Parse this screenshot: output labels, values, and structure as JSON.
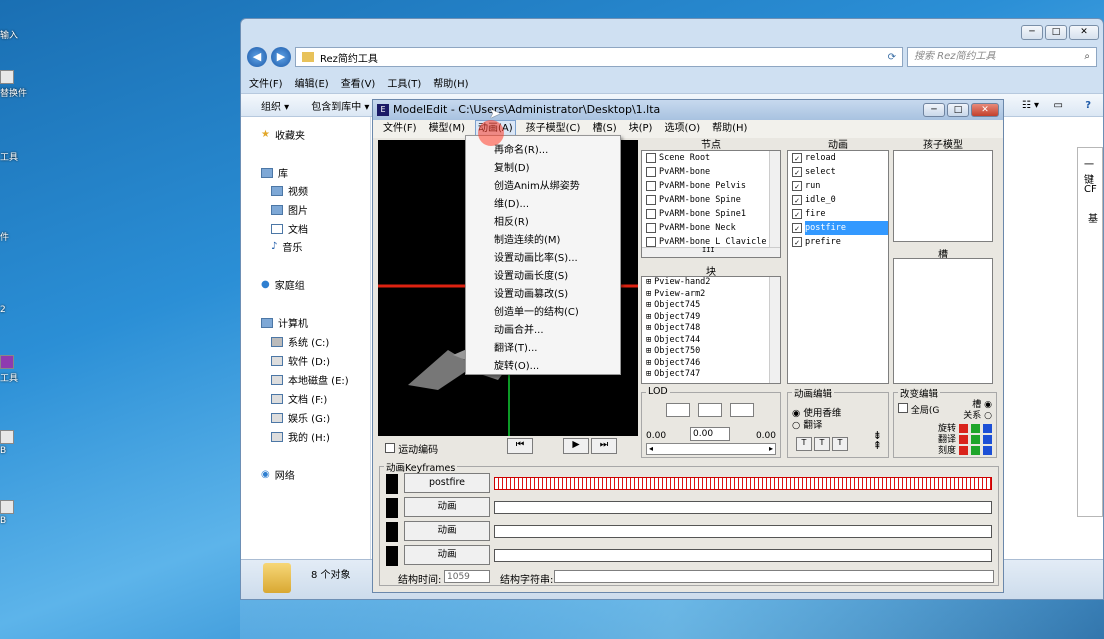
{
  "desktop": {
    "icons": [
      {
        "label": "输入"
      },
      {
        "label": "替换件"
      },
      {
        "label": "工具"
      },
      {
        "label": "件"
      },
      {
        "label": "2"
      },
      {
        "label": "工具"
      },
      {
        "label": "B"
      },
      {
        "label": "B"
      }
    ]
  },
  "explorer": {
    "window_buttons": [
      "─",
      "□",
      "✕"
    ],
    "breadcrumb": "Rez简约工具",
    "search_placeholder": "搜索 Rez简约工具",
    "menu": [
      "文件(F)",
      "编辑(E)",
      "查看(V)",
      "工具(T)",
      "帮助(H)"
    ],
    "toolbar": [
      "组织 ▾",
      "包含到库中 ▾"
    ],
    "nav": {
      "favorites": "收藏夹",
      "library": "库",
      "library_items": [
        "视频",
        "图片",
        "文档",
        "音乐"
      ],
      "homegroup": "家庭组",
      "computer": "计算机",
      "drives": [
        "系统 (C:)",
        "软件 (D:)",
        "本地磁盘 (E:)",
        "文档 (F:)",
        "娱乐 (G:)",
        "我的 (H:)"
      ],
      "network": "网络"
    },
    "status": "8 个对象",
    "right_panel_text": [
      "一键",
      "CF",
      "基"
    ]
  },
  "modeledit": {
    "title": "ModelEdit - C:\\Users\\Administrator\\Desktop\\1.lta",
    "menu": [
      "文件(F)",
      "模型(M)",
      "动画(A)",
      "孩子模型(C)",
      "槽(S)",
      "块(P)",
      "选项(O)",
      "帮助(H)"
    ],
    "headers": {
      "nodes": "节点",
      "anims": "动画",
      "child": "孩子模型",
      "block": "块",
      "slot": "槽"
    },
    "nodes": [
      "Scene Root",
      "PvARM-bone",
      "PvARM-bone Pelvis",
      "PvARM-bone Spine",
      "PvARM-bone Spine1",
      "PvARM-bone Neck",
      "PvARM-bone L Clavicle"
    ],
    "blocks": [
      "Pview-hand2",
      "Pview-arm2",
      "Object745",
      "Object749",
      "Object748",
      "Object744",
      "Object750",
      "Object746",
      "Object747",
      "Object748"
    ],
    "animations": [
      "reload",
      "select",
      "run",
      "idle_0",
      "fire",
      "postfire",
      "prefire"
    ],
    "selected_animation": "postfire",
    "hscroll_mark": "III",
    "lod": {
      "label": "LOD",
      "min": "0.00",
      "value": "0.00",
      "max": "0.00"
    },
    "anim_edit": {
      "label": "动画编辑",
      "opt1": "使用香维",
      "opt2": "翻译",
      "small_btns": [
        "T",
        "T",
        "T"
      ]
    },
    "change_edit": {
      "label": "改变编辑",
      "global": "全局(G",
      "slot": "槽",
      "relation": "关系",
      "rows": [
        "旋转",
        "翻译",
        "刻度"
      ]
    },
    "motion": {
      "label": "运动编码"
    },
    "keyframes": {
      "label": "动画Keyframes",
      "rows": [
        "postfire",
        "动画",
        "动画",
        "动画"
      ]
    },
    "struct_time_label": "结构时间:",
    "struct_time_value": "1059",
    "struct_string_label": "结构字符串:"
  },
  "dropdown": {
    "items": [
      "再命名(R)...",
      "复制(D)",
      "创造Anim从绑姿势",
      "维(D)...",
      "相反(R)",
      "制造连续的(M)",
      "设置动画比率(S)...",
      "设置动画长度(S)",
      "设置动画篡改(S)",
      "创造单一的结构(C)",
      "动画合并...",
      "翻译(T)...",
      "旋转(O)..."
    ]
  },
  "colors": {
    "red": "#d9231b",
    "green": "#1fa52a",
    "blue": "#1c4fd6",
    "selection": "#3399ff"
  }
}
